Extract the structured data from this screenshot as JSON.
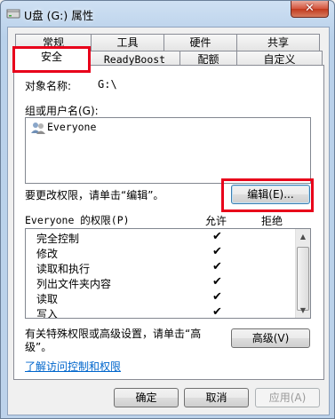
{
  "window": {
    "title": "U盘 (G:) 属性",
    "close_glyph": "✕"
  },
  "tabs_row1": [
    {
      "label": "常规"
    },
    {
      "label": "工具"
    },
    {
      "label": "硬件"
    },
    {
      "label": "共享"
    }
  ],
  "tabs_row2": [
    {
      "label": "安全",
      "active": true
    },
    {
      "label": "ReadyBoost"
    },
    {
      "label": "配额"
    },
    {
      "label": "自定义"
    }
  ],
  "security": {
    "object_name_label": "对象名称:",
    "object_name_value": "G:\\",
    "group_label": "组或用户名(G):",
    "users": [
      {
        "name": "Everyone",
        "icon": "users-icon"
      }
    ],
    "change_prompt": "要更改权限，请单击“编辑”。",
    "edit_button": "编辑(E)...",
    "perm_header": "Everyone 的权限(P)",
    "allow_header": "允许",
    "deny_header": "拒绝",
    "permissions": [
      {
        "name": "完全控制",
        "allow": "✔",
        "deny": ""
      },
      {
        "name": "修改",
        "allow": "✔",
        "deny": ""
      },
      {
        "name": "读取和执行",
        "allow": "✔",
        "deny": ""
      },
      {
        "name": "列出文件夹内容",
        "allow": "✔",
        "deny": ""
      },
      {
        "name": "读取",
        "allow": "✔",
        "deny": ""
      },
      {
        "name": "写入",
        "allow": "✔",
        "deny": ""
      }
    ],
    "advanced_prompt_line1": "有关特殊权限或高级设置，请单击“高",
    "advanced_prompt_line2": "级”。",
    "advanced_button": "高级(V)",
    "learn_link": "了解访问控制和权限"
  },
  "footer": {
    "ok": "确定",
    "cancel": "取消",
    "apply": "应用(A)"
  },
  "colors": {
    "highlight": "#e8001a",
    "link": "#0066cc"
  }
}
